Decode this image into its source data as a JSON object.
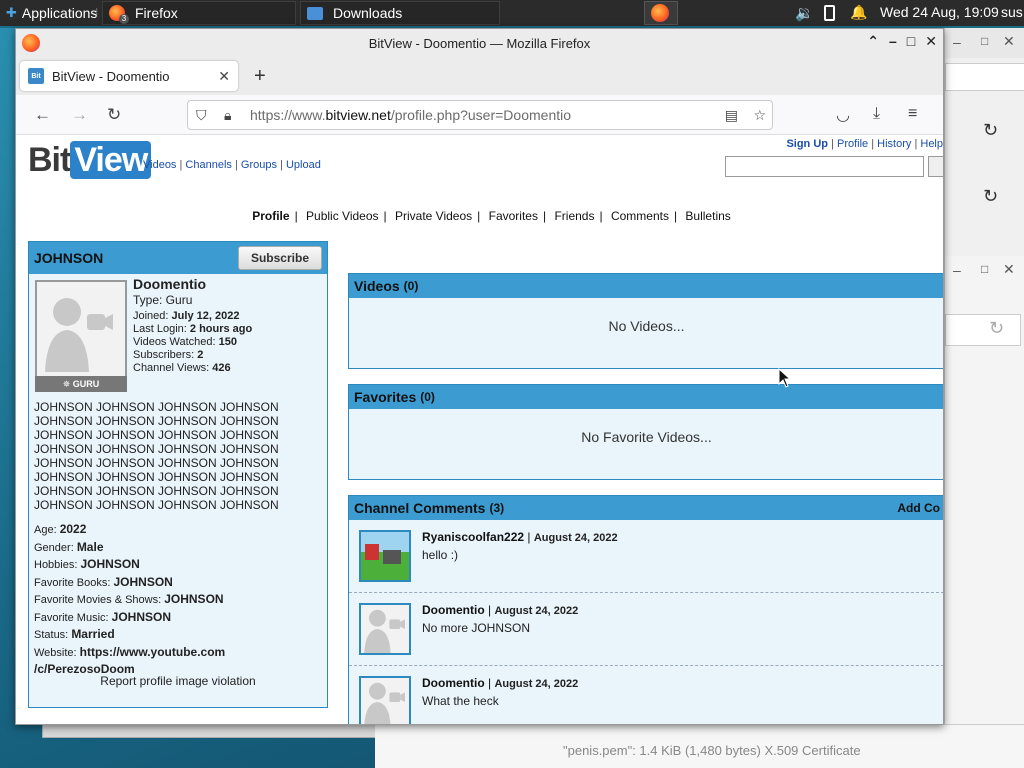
{
  "panel": {
    "applications": "Applications",
    "tasks": [
      {
        "label": "Firefox",
        "badge": "3"
      },
      {
        "label": "Downloads"
      }
    ],
    "clock": "Wed 24 Aug, 19:09",
    "user": "sus"
  },
  "window": {
    "title": "BitView - Doomentio — Mozilla Firefox",
    "tab_title": "BitView - Doomentio",
    "url_prefix": "https://www.",
    "url_domain": "bitview.net",
    "url_path": "/profile.php?user=Doomentio"
  },
  "site": {
    "logo_bit": "Bit",
    "logo_view": "View",
    "top_links": [
      "Videos",
      "Channels",
      "Groups",
      "Upload"
    ],
    "right_links": [
      "Sign Up",
      "Profile",
      "History",
      "Help"
    ],
    "subnav": [
      "Profile",
      "Public Videos",
      "Private Videos",
      "Favorites",
      "Friends",
      "Comments",
      "Bulletins"
    ]
  },
  "profile": {
    "header": "JOHNSON",
    "subscribe": "Subscribe",
    "username": "Doomentio",
    "type": "Type: Guru",
    "joined_label": "Joined:",
    "joined": "July 12, 2022",
    "login_label": "Last Login:",
    "login": "2 hours ago",
    "watched_label": "Videos Watched:",
    "watched": "150",
    "subs_label": "Subscribers:",
    "subs": "2",
    "views_label": "Channel Views:",
    "views": "426",
    "badge": "GURU",
    "bio": "JOHNSON JOHNSON JOHNSON JOHNSON JOHNSON JOHNSON JOHNSON JOHNSON JOHNSON JOHNSON JOHNSON JOHNSON JOHNSON JOHNSON JOHNSON JOHNSON JOHNSON JOHNSON JOHNSON JOHNSON JOHNSON JOHNSON JOHNSON JOHNSON JOHNSON JOHNSON JOHNSON JOHNSON JOHNSON JOHNSON JOHNSON JOHNSON",
    "age_label": "Age:",
    "age": "2022",
    "gender_label": "Gender:",
    "gender": "Male",
    "hobbies_label": "Hobbies:",
    "hobbies": "JOHNSON",
    "books_label": "Favorite Books:",
    "books": "JOHNSON",
    "movies_label": "Favorite Movies & Shows:",
    "movies": "JOHNSON",
    "music_label": "Favorite Music:",
    "music": "JOHNSON",
    "status_label": "Status:",
    "status": "Married",
    "website_label": "Website:",
    "website_1": "https://www.youtube.com",
    "website_2": "/c/PerezosoDoom",
    "report": "Report profile image violation"
  },
  "sections": {
    "videos_title": "Videos",
    "videos_count": "(0)",
    "videos_empty": "No Videos...",
    "favorites_title": "Favorites",
    "favorites_count": "(0)",
    "favorites_empty": "No Favorite Videos...",
    "comments_title": "Channel Comments",
    "comments_count": "(3)",
    "comments_add": "Add Co"
  },
  "comments": [
    {
      "user": "Ryaniscoolfan222",
      "date": "August 24, 2022",
      "text": "hello :)"
    },
    {
      "user": "Doomentio",
      "date": "August 24, 2022",
      "text": "No more JOHNSON"
    },
    {
      "user": "Doomentio",
      "date": "August 24, 2022",
      "text": "What the heck"
    }
  ],
  "bottom_status": "\"penis.pem\": 1.4 KiB (1,480 bytes) X.509 Certificate"
}
